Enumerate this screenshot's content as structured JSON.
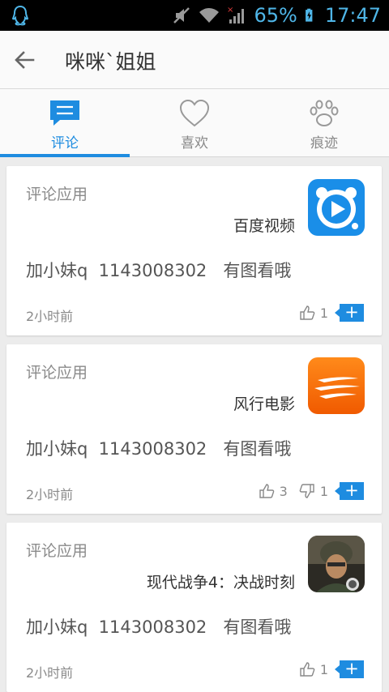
{
  "status_bar": {
    "battery": "65%",
    "time": "17:47"
  },
  "header": {
    "title": "咪咪`姐姐"
  },
  "tabs": [
    {
      "label": "评论",
      "icon": "comment-icon",
      "active": true
    },
    {
      "label": "喜欢",
      "icon": "heart-icon",
      "active": false
    },
    {
      "label": "痕迹",
      "icon": "paw-icon",
      "active": false
    }
  ],
  "cards": [
    {
      "type": "评论应用",
      "app_name": "百度视频",
      "app_icon": "baidu-video-icon",
      "comment": "加小妹q  1143008302   有图看哦",
      "time": "2小时前",
      "likes": "1",
      "dislikes": null
    },
    {
      "type": "评论应用",
      "app_name": "风行电影",
      "app_icon": "funshion-icon",
      "comment": "加小妹q  1143008302   有图看哦",
      "time": "2小时前",
      "likes": "3",
      "dislikes": "1"
    },
    {
      "type": "评论应用",
      "app_name": "现代战争4：决战时刻",
      "app_icon": "modern-combat-icon",
      "comment": "加小妹q  1143008302   有图看哦",
      "time": "2小时前",
      "likes": "1",
      "dislikes": null
    }
  ],
  "colors": {
    "accent": "#1e8ce0",
    "statusbar_text": "#4fb6e8"
  }
}
